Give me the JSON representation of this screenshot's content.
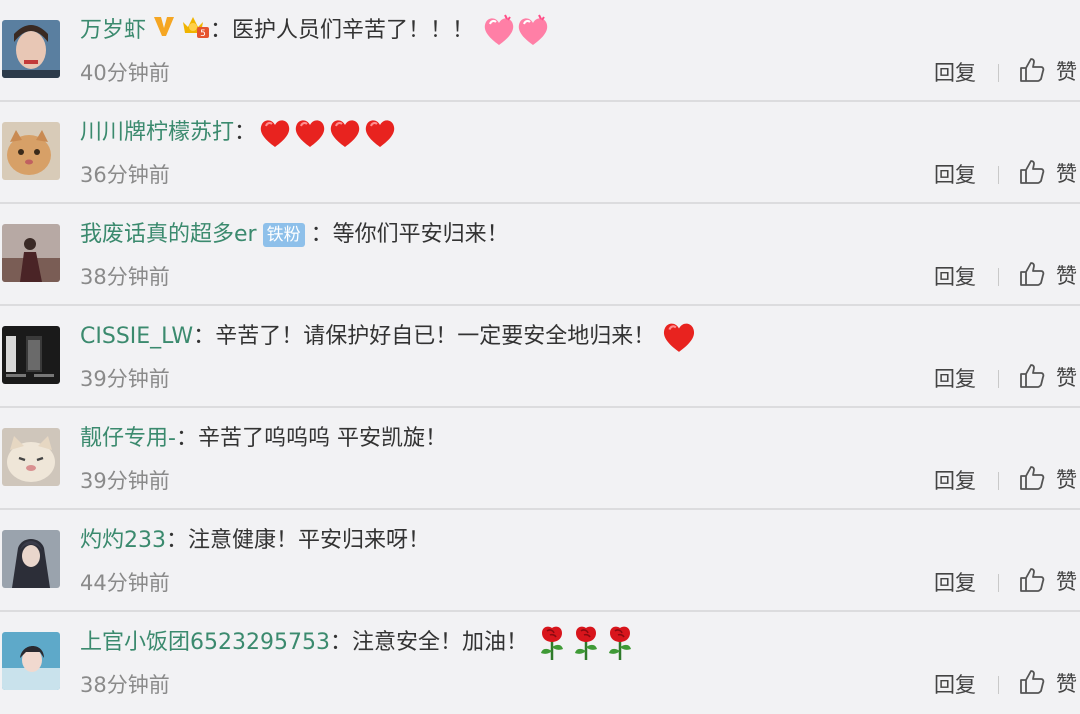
{
  "labels": {
    "reply": "回复",
    "like": "赞",
    "colon": "："
  },
  "comments": [
    {
      "user": "万岁虾",
      "text": "医护人员们辛苦了！！！",
      "time": "40分钟前"
    },
    {
      "user": "川川牌柠檬苏打",
      "text": "",
      "time": "36分钟前"
    },
    {
      "user": "我废话真的超多er",
      "badge": "铁粉",
      "text": "等你们平安归来！",
      "time": "38分钟前"
    },
    {
      "user": "CISSIE_LW",
      "text": "辛苦了！请保护好自已！一定要安全地归来！",
      "time": "39分钟前"
    },
    {
      "user": "靓仔专用-",
      "text": "辛苦了呜呜呜 平安凯旋！",
      "time": "39分钟前"
    },
    {
      "user": "灼灼233",
      "text": "注意健康！平安归来呀！",
      "time": "44分钟前"
    },
    {
      "user": "上官小饭团6523295753",
      "text": "注意安全！加油！",
      "time": "38分钟前"
    }
  ],
  "icons": [
    "verified-v-icon",
    "vip-crown-icon",
    "heart-icon",
    "rose-icon",
    "thumbs-up-icon"
  ],
  "colors": {
    "username": "#3b8a6e",
    "time": "#8a8a8a",
    "background": "#f2f2f4",
    "badge": "#8ec0ea"
  }
}
